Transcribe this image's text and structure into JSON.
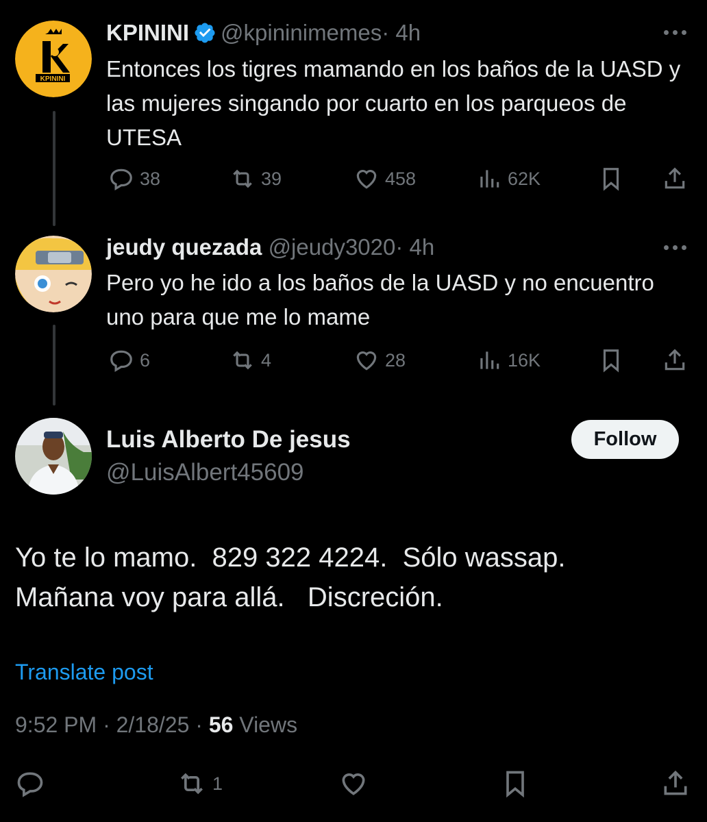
{
  "tweets": [
    {
      "name": "KPININI",
      "verified": true,
      "handle": "@kpininimemes",
      "time": "· 4h",
      "text": "Entonces los tigres mamando en los baños de la UASD y las mujeres singando por cuarto en los parqueos de UTESA",
      "replies": "38",
      "reposts": "39",
      "likes": "458",
      "views": "62K",
      "avatar_logo_text": "KPININI"
    },
    {
      "name": "jeudy quezada",
      "verified": false,
      "handle": "@jeudy3020",
      "time": "· 4h",
      "text": "Pero yo he ido a los baños de la UASD y no encuentro uno para que me lo mame",
      "replies": "6",
      "reposts": "4",
      "likes": "28",
      "views": "16K"
    }
  ],
  "main_tweet": {
    "name": "Luis Alberto De jesus",
    "handle": "@LuisAlbert45609",
    "follow_label": "Follow",
    "text": "Yo te lo mamo.  829 322 4224.  Sólo wassap.\nMañana voy para allá.   Discreción.",
    "translate_label": "Translate post",
    "time": "9:52 PM",
    "date": "2/18/25",
    "views_count": "56",
    "views_label": "Views",
    "reposts": "1"
  },
  "colors": {
    "background": "#000000",
    "text": "#e7e9ea",
    "secondary": "#71767b",
    "accent": "#1d9bf0",
    "kpinini_yellow": "#f5b21c"
  }
}
